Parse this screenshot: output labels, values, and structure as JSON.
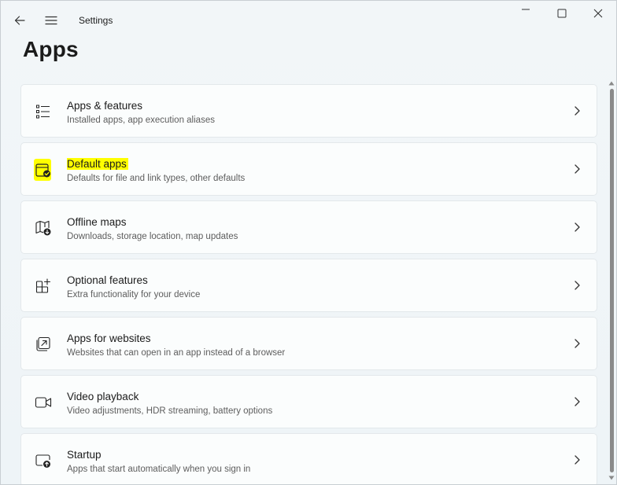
{
  "window": {
    "app_title": "Settings",
    "controls": [
      "minimize-icon",
      "maximize-icon",
      "close-icon"
    ]
  },
  "page": {
    "title": "Apps"
  },
  "items": [
    {
      "title": "Apps & features",
      "subtitle": "Installed apps, app execution aliases",
      "icon": "list-icon",
      "highlighted": false
    },
    {
      "title": "Default apps",
      "subtitle": "Defaults for file and link types, other defaults",
      "icon": "default-apps-icon",
      "highlighted": true
    },
    {
      "title": "Offline maps",
      "subtitle": "Downloads, storage location, map updates",
      "icon": "map-download-icon",
      "highlighted": false
    },
    {
      "title": "Optional features",
      "subtitle": "Extra functionality for your device",
      "icon": "add-grid-icon",
      "highlighted": false
    },
    {
      "title": "Apps for websites",
      "subtitle": "Websites that can open in an app instead of a browser",
      "icon": "open-in-app-icon",
      "highlighted": false
    },
    {
      "title": "Video playback",
      "subtitle": "Video adjustments, HDR streaming, battery options",
      "icon": "video-icon",
      "highlighted": false
    },
    {
      "title": "Startup",
      "subtitle": "Apps that start automatically when you sign in",
      "icon": "startup-icon",
      "highlighted": false
    }
  ],
  "colors": {
    "highlight": "#ffff00",
    "card_background": "#fbfdfd",
    "window_background": "#eef4f7"
  }
}
